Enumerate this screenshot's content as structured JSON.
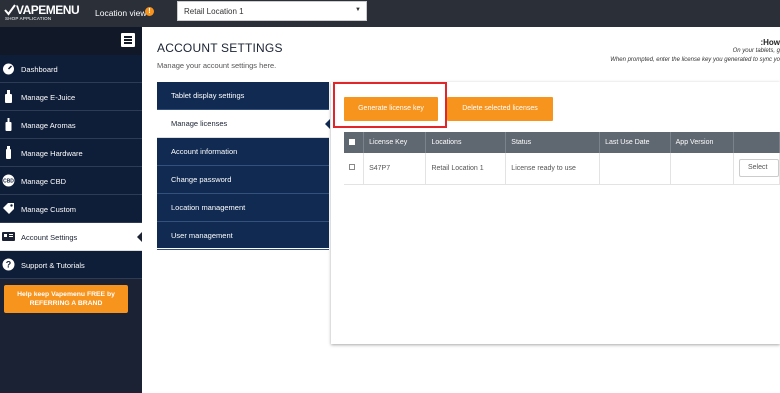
{
  "topbar": {
    "logo_name": "VAPEMENU",
    "logo_sub": "SHOP APPLICATION",
    "location_label": "Location view",
    "info_badge": "!",
    "location_value": "Retail Location 1",
    "location_caret": "▼"
  },
  "sidebar": {
    "items": [
      {
        "label": "Dashboard",
        "icon": "dashboard-icon"
      },
      {
        "label": "Manage E-Juice",
        "icon": "ejuice-bottle-icon"
      },
      {
        "label": "Manage Aromas",
        "icon": "aroma-bottle-icon"
      },
      {
        "label": "Manage Hardware",
        "icon": "vape-device-icon"
      },
      {
        "label": "Manage CBD",
        "icon": "cbd-icon"
      },
      {
        "label": "Manage Custom",
        "icon": "tag-icon"
      },
      {
        "label": "Account Settings",
        "icon": "id-card-icon"
      },
      {
        "label": "Support & Tutorials",
        "icon": "question-icon"
      }
    ],
    "active_index": 6,
    "referral_line1": "Help keep Vapemenu FREE by",
    "referral_line2": "REFERRING A BRAND"
  },
  "header": {
    "title": "ACCOUNT SETTINGS",
    "subtitle": "Manage your account settings here.",
    "howto_title": ":How",
    "howto_line1": "On your tablets, g",
    "howto_line2": "When prompted, enter the license key you generated to sync yo"
  },
  "settings_menu": {
    "items": [
      "Tablet display settings",
      "Manage licenses",
      "Account information",
      "Change password",
      "Location management",
      "User management"
    ],
    "active_index": 1
  },
  "licenses": {
    "generate_label": "Generate license key",
    "delete_label": "Delete selected licenses",
    "columns": [
      "License Key",
      "Locations",
      "Status",
      "Last Use Date",
      "App Version"
    ],
    "rows": [
      {
        "key": "S47P7",
        "location": "Retail Location 1",
        "status": "License ready to use",
        "last_use": "",
        "app_version": "",
        "action": "Select"
      }
    ]
  },
  "colors": {
    "topbar": "#2a2f38",
    "sidebar": "#0e1d38",
    "menu": "#102a52",
    "accent": "#f7941d",
    "highlight": "#e0262a",
    "table_header": "#5f6770"
  }
}
